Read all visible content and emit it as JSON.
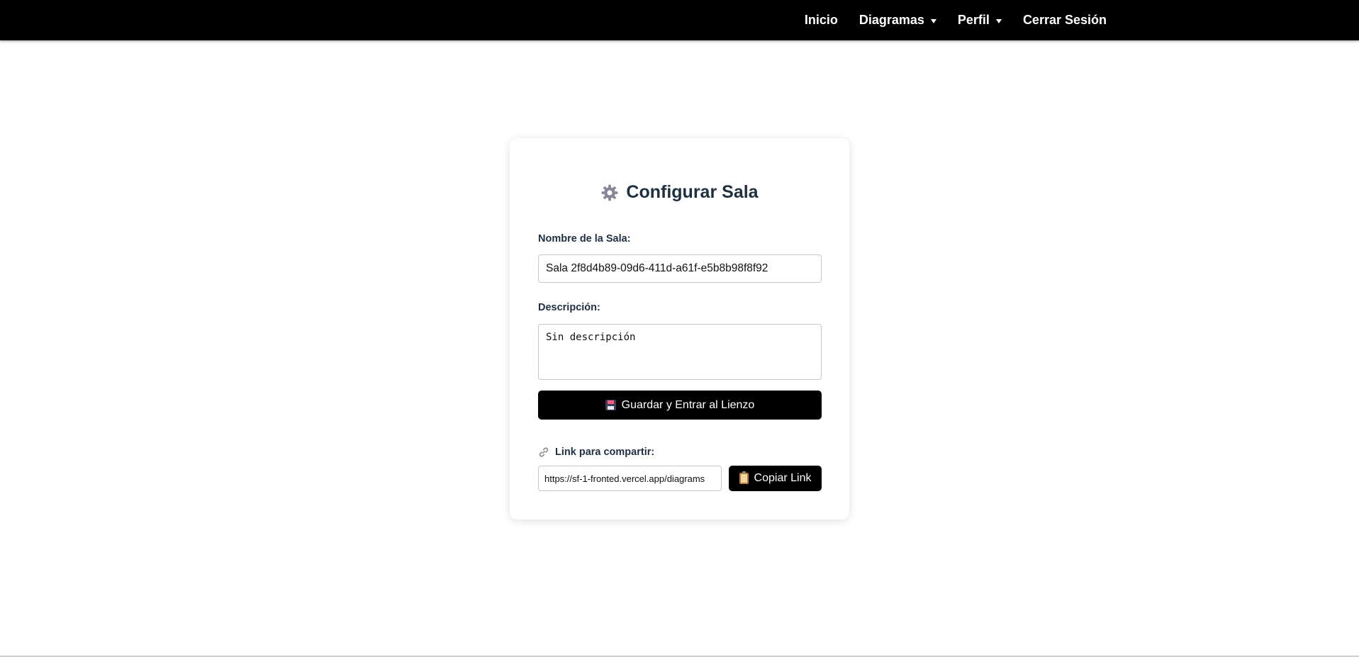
{
  "nav": {
    "items": [
      {
        "label": "Inicio",
        "dropdown": false
      },
      {
        "label": "Diagramas",
        "dropdown": true
      },
      {
        "label": "Perfil",
        "dropdown": true
      },
      {
        "label": "Cerrar Sesión",
        "dropdown": false
      }
    ]
  },
  "card": {
    "title": "Configurar Sala",
    "title_icon": "gear-icon",
    "name_label": "Nombre de la Sala:",
    "name_value": "Sala 2f8d4b89-09d6-411d-a61f-e5b8b98f8f92",
    "description_label": "Descripción:",
    "description_value": "Sin descripción",
    "save_button_label": "Guardar y Entrar al Lienzo",
    "save_button_icon": "floppy-disk-icon",
    "share_label": "Link para compartir:",
    "share_icon": "link-icon",
    "share_link_value": "https://sf-1-fronted.vercel.app/diagrams",
    "copy_button_label": "Copiar Link",
    "copy_button_icon": "clipboard-icon"
  },
  "colors": {
    "navbar_bg": "#000000",
    "title_text": "#1e2f42",
    "button_bg": "#000000"
  }
}
